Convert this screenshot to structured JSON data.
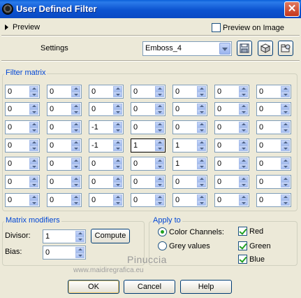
{
  "window": {
    "title": "User Defined Filter",
    "close_glyph": "✕"
  },
  "preview": {
    "label": "Preview",
    "on_image_label": "Preview on Image",
    "on_image_checked": false
  },
  "settings": {
    "label": "Settings",
    "preset": "Emboss_4"
  },
  "filter_matrix": {
    "title": "Filter matrix",
    "rows": [
      [
        "0",
        "0",
        "0",
        "0",
        "0",
        "0",
        "0"
      ],
      [
        "0",
        "0",
        "0",
        "0",
        "0",
        "0",
        "0"
      ],
      [
        "0",
        "0",
        "-1",
        "0",
        "0",
        "0",
        "0"
      ],
      [
        "0",
        "0",
        "-1",
        "1",
        "1",
        "0",
        "0"
      ],
      [
        "0",
        "0",
        "0",
        "0",
        "1",
        "0",
        "0"
      ],
      [
        "0",
        "0",
        "0",
        "0",
        "0",
        "0",
        "0"
      ],
      [
        "0",
        "0",
        "0",
        "0",
        "0",
        "0",
        "0"
      ]
    ]
  },
  "matrix_modifiers": {
    "title": "Matrix modifiers",
    "divisor_label": "Divisor:",
    "divisor": "1",
    "bias_label": "Bias:",
    "bias": "0",
    "compute_label": "Compute"
  },
  "apply_to": {
    "title": "Apply to",
    "color_channels": "Color Channels:",
    "grey_values": "Grey values",
    "selected": "color_channels",
    "red": "Red",
    "green": "Green",
    "blue": "Blue"
  },
  "watermark": {
    "line1": "Pinuccia",
    "line2": "www.maidiregrafica.eu"
  },
  "buttons": {
    "ok": "OK",
    "cancel": "Cancel",
    "help": "Help"
  }
}
